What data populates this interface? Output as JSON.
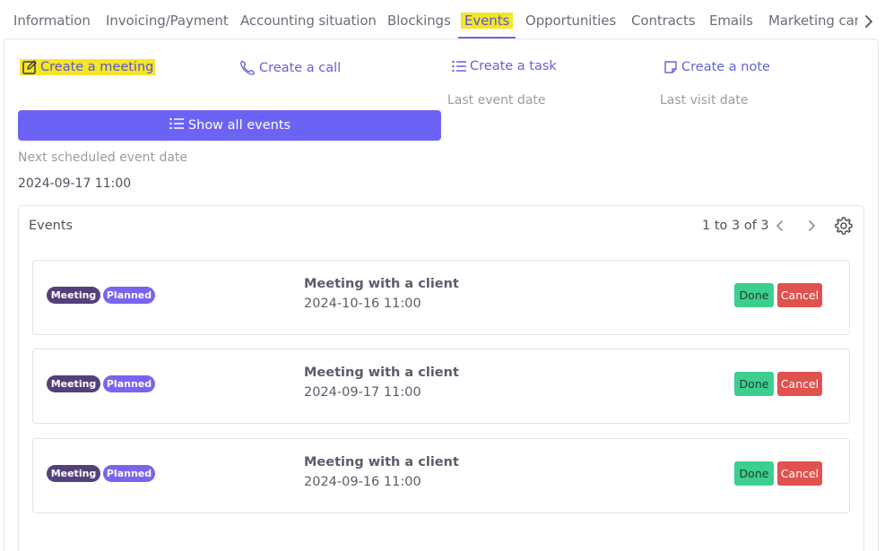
{
  "tabs": [
    {
      "label": "Information"
    },
    {
      "label": "Invoicing/Payment"
    },
    {
      "label": "Accounting situation"
    },
    {
      "label": "Blockings"
    },
    {
      "label": "Events",
      "active": true
    },
    {
      "label": "Opportunities"
    },
    {
      "label": "Contracts"
    },
    {
      "label": "Emails"
    },
    {
      "label": "Marketing cam"
    }
  ],
  "actions": {
    "meeting": "Create a meeting",
    "call": "Create a call",
    "task": "Create a task",
    "note": "Create a note"
  },
  "meta": {
    "last_event_label": "Last event date",
    "last_visit_label": "Last visit date",
    "next_event_label": "Next scheduled event date",
    "next_event_value": "2024-09-17 11:00"
  },
  "show_all_label": "Show all events",
  "events": {
    "title": "Events",
    "pager": "1 to 3 of 3",
    "rows": [
      {
        "type": "Meeting",
        "status": "Planned",
        "title": "Meeting with a client",
        "date": "2024-10-16 11:00",
        "done": "Done",
        "cancel": "Cancel"
      },
      {
        "type": "Meeting",
        "status": "Planned",
        "title": "Meeting with a client",
        "date": "2024-09-17 11:00",
        "done": "Done",
        "cancel": "Cancel"
      },
      {
        "type": "Meeting",
        "status": "Planned",
        "title": "Meeting with a client",
        "date": "2024-09-16 11:00",
        "done": "Done",
        "cancel": "Cancel"
      }
    ]
  },
  "colors": {
    "accent": "#6c63f5",
    "highlight": "#f5e52a",
    "badge_type": "#54407a",
    "badge_status": "#7a63ef",
    "done": "#3ccf8e",
    "cancel": "#e0524e"
  },
  "icons": {
    "meeting": "edit-square-icon",
    "call": "phone-icon",
    "task": "list-icon",
    "note": "sticky-note-icon",
    "show_all": "list-icon",
    "settings": "gear-icon",
    "prev": "chevron-left-icon",
    "next": "chevron-right-icon",
    "tabs_scroll": "chevron-right-icon"
  }
}
